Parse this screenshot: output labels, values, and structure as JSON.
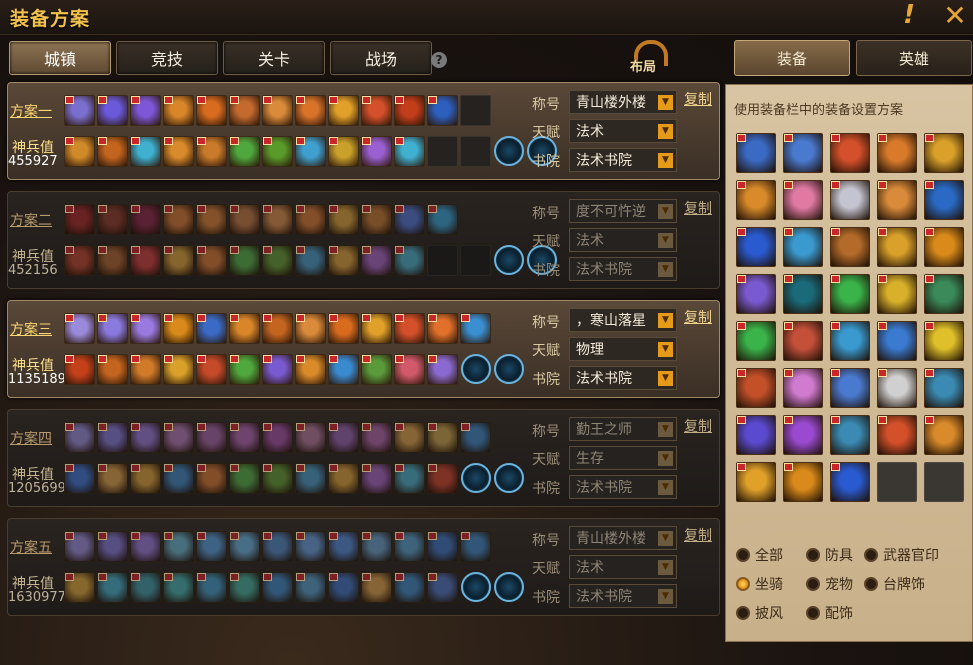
{
  "window": {
    "title": "装备方案",
    "warning_icon": "exclamation-icon",
    "close_icon": "close-icon"
  },
  "tabs": [
    {
      "label": "城镇",
      "active": true
    },
    {
      "label": "竞技",
      "active": false
    },
    {
      "label": "关卡",
      "active": false
    },
    {
      "label": "战场",
      "active": false
    }
  ],
  "help_label": "?",
  "layout_button": {
    "label": "布局"
  },
  "field_labels": {
    "title": "称号",
    "talent": "天赋",
    "academy": "书院"
  },
  "copy_label": "复制",
  "power_label": "神兵值",
  "plans": [
    {
      "name": "方案一",
      "power": "455927",
      "title": "青山楼外楼",
      "talent": "法术",
      "academy": "法术书院",
      "active": true,
      "row1": [
        "#7a6fcf",
        "#6a5adb",
        "#7d57d8",
        "#d9862a",
        "#d96b1f",
        "#c46a2f",
        "#d98a3a",
        "#d9732a",
        "#e0a02a",
        "#d4502a",
        "#c43d1a",
        "#2d5fbf",
        "empty"
      ],
      "row2": [
        "#d18a2a",
        "#c4651f",
        "#3fb0d0",
        "#d98a2a",
        "#c97a2a",
        "#4fa83d",
        "#5a9a2a",
        "#3fa0d0",
        "#c9a02a",
        "#9a5fd0",
        "#3fb0d0",
        "empty",
        "empty"
      ]
    },
    {
      "name": "方案二",
      "power": "452156",
      "title": "度不可忤逆",
      "talent": "法术",
      "academy": "法术书院",
      "active": false,
      "row1": [
        "#a32a2a",
        "#8a3a2a",
        "#8a2a4a",
        "#c46a2a",
        "#c4702a",
        "#b36a3a",
        "#c47a3a",
        "#c46a2a",
        "#c48a2a",
        "#b36a2a",
        "#4a6ac4",
        "#2f8fbf"
      ],
      "row2": [
        "#b3402a",
        "#a35a2a",
        "#c43a3a",
        "#c48a2a",
        "#c46a2a",
        "#4a9a3a",
        "#5a8a2a",
        "#3f8ab3",
        "#c48a2a",
        "#9a5ab3",
        "#3f9ab3",
        "empty",
        "empty"
      ]
    },
    {
      "name": "方案三",
      "power": "1135189",
      "title": "，寒山落星",
      "talent": "物理",
      "academy": "法术书院",
      "active": true,
      "row1": [
        "#9a8adb",
        "#8a7ae0",
        "#9a7ae0",
        "#d98a1a",
        "#3a6ac4",
        "#d9862a",
        "#c4651f",
        "#d98a3a",
        "#d96b1f",
        "#e0a02a",
        "#d4502a",
        "#e0702a",
        "#3a8fd0"
      ],
      "row2": [
        "#c4401a",
        "#c4651f",
        "#d07a2a",
        "#d9a02a",
        "#c44a2a",
        "#4fa83d",
        "#7a5ad0",
        "#d98a2a",
        "#3a8ad0",
        "#5a9a3a",
        "#d05a6a",
        "#8a6ad0"
      ]
    },
    {
      "name": "方案四",
      "power": "1205699",
      "title": "勤王之师",
      "talent": "生存",
      "academy": "法术书院",
      "active": false,
      "row1": [
        "#8a7ac4",
        "#7a6ac4",
        "#8a6ac4",
        "#a36aa3",
        "#9a5a9a",
        "#a35aa3",
        "#9a4a9a",
        "#a36a8a",
        "#8a5aa3",
        "#a35a9a",
        "#c48a3a",
        "#b38a3a",
        "#3a7ab3"
      ],
      "row2": [
        "#3a6ac4",
        "#c48a3a",
        "#c48a2a",
        "#3a7ab3",
        "#c46a2a",
        "#4a9a3a",
        "#5a8a2a",
        "#3f8ab3",
        "#c48a2a",
        "#9a5ab3",
        "#3f9ab3",
        "#c4402a"
      ]
    },
    {
      "name": "方案五",
      "power": "1630977",
      "title": "青山楼外楼",
      "talent": "法术",
      "academy": "法术书院",
      "active": false,
      "row1": [
        "#8a7ac4",
        "#7a6ac4",
        "#8a6ac4",
        "#5a9ab3",
        "#4a8ac4",
        "#5a9ac4",
        "#4a7ab3",
        "#5a8ac4",
        "#4a7ac4",
        "#5a8ab3",
        "#4a8ab3",
        "#3a6ab3",
        "#3a7ab3"
      ],
      "row2": [
        "#c4902a",
        "#3a9ab3",
        "#3a8a9a",
        "#3a9a9a",
        "#3a8ab3",
        "#3a9a8a",
        "#3a7ab3",
        "#4a8ab3",
        "#3a6ab3",
        "#c48a3a",
        "#3a7ab3",
        "#4a6ab3"
      ]
    }
  ],
  "right_tabs": [
    {
      "label": "装备",
      "active": true
    },
    {
      "label": "英雄",
      "active": false
    }
  ],
  "panel": {
    "description": "使用装备栏中的装备设置方案",
    "items": [
      "#3a6ac4",
      "#4a7ad0",
      "#d4502a",
      "#d97a2a",
      "#d9a02a",
      "#d98a2a",
      "#e07aa3",
      "#c4c4d0",
      "#d98a3a",
      "#2a6ac4",
      "#2a5ad0",
      "#3a9ad0",
      "#b36a2a",
      "#d9a02a",
      "#d98a1a",
      "#7a5ad0",
      "#1a6a7a",
      "#3ab34a",
      "#d9b02a",
      "#3a8a5a",
      "#3ab34a",
      "#c4503a",
      "#3a9ad0",
      "#3a7ad0",
      "#e0c02a",
      "#c4502a",
      "#d07ad0",
      "#4a7ad0",
      "#d0d0d0",
      "#3a8ab3",
      "#5a4ad0",
      "#9a4ad0",
      "#3a8ab3",
      "#d4502a",
      "#d98a2a",
      "#e0a02a",
      "#d98a1a",
      "#2a5ad0",
      "empty",
      "empty"
    ]
  },
  "filters": [
    {
      "label": "全部",
      "checked": false
    },
    {
      "label": "防具",
      "checked": false
    },
    {
      "label": "武器官印",
      "checked": false
    },
    {
      "label": "坐骑",
      "checked": true
    },
    {
      "label": "宠物",
      "checked": false
    },
    {
      "label": "台牌饰",
      "checked": false
    },
    {
      "label": "披风",
      "checked": false
    },
    {
      "label": "配饰",
      "checked": false
    }
  ]
}
